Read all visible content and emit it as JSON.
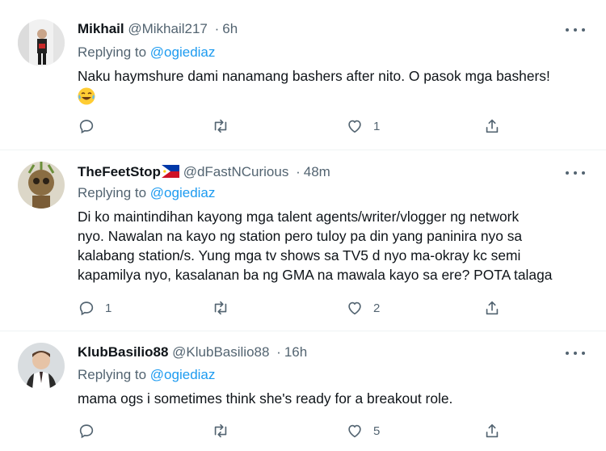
{
  "reply_prefix": "Replying to",
  "tweets": [
    {
      "name": "Mikhail",
      "handle": "@Mikhail217",
      "separator": "·",
      "time": "6h",
      "reply_to": "@ogiediaz",
      "text": "Naku haymshure dami nanamang bashers after nito. O pasok mga bashers!",
      "emoji": "face-with-tears-of-joy",
      "reply_count": "",
      "retweet_count": "",
      "like_count": "1"
    },
    {
      "name": "TheFeetStop",
      "flag": "philippines-flag",
      "handle": "@dFastNCurious",
      "separator": "·",
      "time": "48m",
      "reply_to": "@ogiediaz",
      "text_lines": [
        "Di ko maintindihan kayong mga talent agents/writer/vlogger ng network",
        "nyo. Nawalan na kayo ng station pero tuloy pa din yang paninira nyo sa",
        "kalabang station/s. Yung mga tv shows sa TV5 d nyo ma-okray kc semi",
        "kapamilya nyo, kasalanan ba ng GMA na mawala kayo sa ere? POTA talaga"
      ],
      "reply_count": "1",
      "retweet_count": "",
      "like_count": "2"
    },
    {
      "name": "KlubBasilio88",
      "handle": "@KlubBasilio88",
      "separator": "·",
      "time": "16h",
      "reply_to": "@ogiediaz",
      "text": "mama ogs i sometimes think she's ready for a breakout role.",
      "reply_count": "",
      "retweet_count": "",
      "like_count": "5"
    }
  ],
  "colors": {
    "text": "#0f1419",
    "secondary": "#536471",
    "link": "#1d9bf0",
    "divider": "#eff3f4"
  }
}
